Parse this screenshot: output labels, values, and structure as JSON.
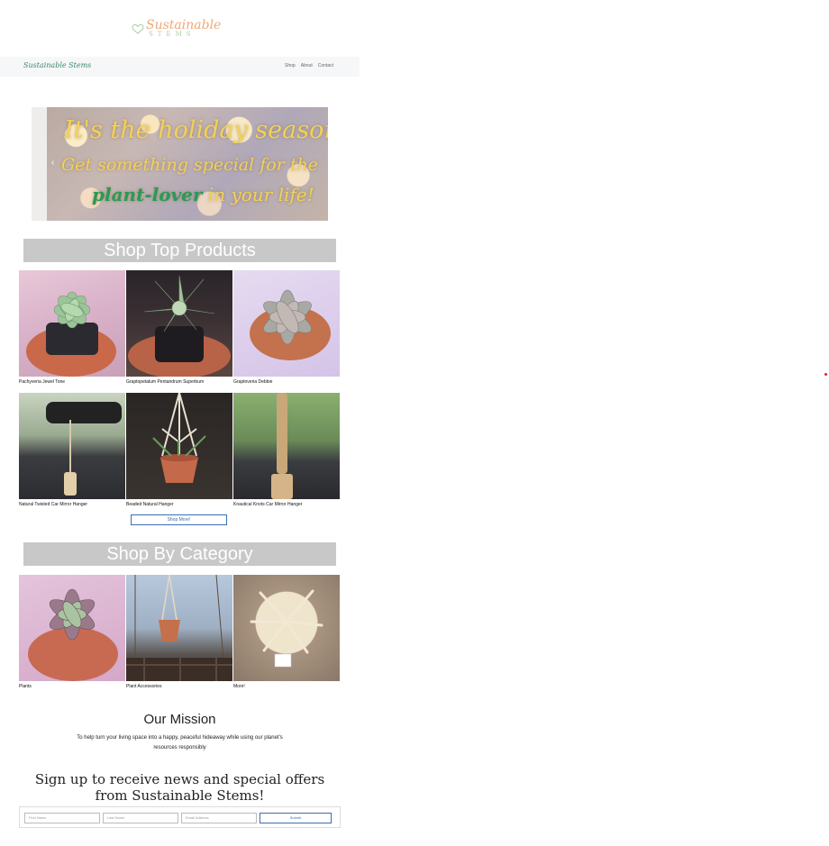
{
  "logo": {
    "line1": "Sustainable",
    "line2": "STEMS"
  },
  "navbar": {
    "brand": "Sustainable Stems",
    "links": [
      "Shop",
      "About",
      "Contact"
    ]
  },
  "banner": {
    "line1": "It's the holiday season...",
    "line2": "Get something special for the",
    "line3_highlight": "plant-lover",
    "line3_rest": " in your life!"
  },
  "top_products": {
    "heading": "Shop Top Products",
    "items": [
      {
        "name": "Pachyveria Jewel Tone"
      },
      {
        "name": "Graptopetalum Pentandrum Superbum"
      },
      {
        "name": "Graptoveria Debbie"
      },
      {
        "name": "Natural Twisted Car Mirror Hanger"
      },
      {
        "name": "Beaded Natural Hanger"
      },
      {
        "name": "Knautical Knots Car Mirror Hanger"
      }
    ],
    "more_button": "Shop More!"
  },
  "categories": {
    "heading": "Shop By Category",
    "items": [
      {
        "name": "Plants"
      },
      {
        "name": "Plant Accessories"
      },
      {
        "name": "More!"
      }
    ]
  },
  "mission": {
    "title": "Our Mission",
    "text": "To help turn your living space into a happy, peaceful hideaway while using our planet's resources responsibly"
  },
  "signup": {
    "title": "Sign up to receive news and special offers from Sustainable Stems!",
    "first_name_placeholder": "First Name",
    "last_name_placeholder": "Last Name",
    "email_placeholder": "Email Address",
    "submit_label": "Submit"
  },
  "colors": {
    "brand_green": "#3c8a6a",
    "logo_peach": "#f0a878",
    "header_gray": "#c8c8c8",
    "button_blue": "#3a6fb0"
  }
}
